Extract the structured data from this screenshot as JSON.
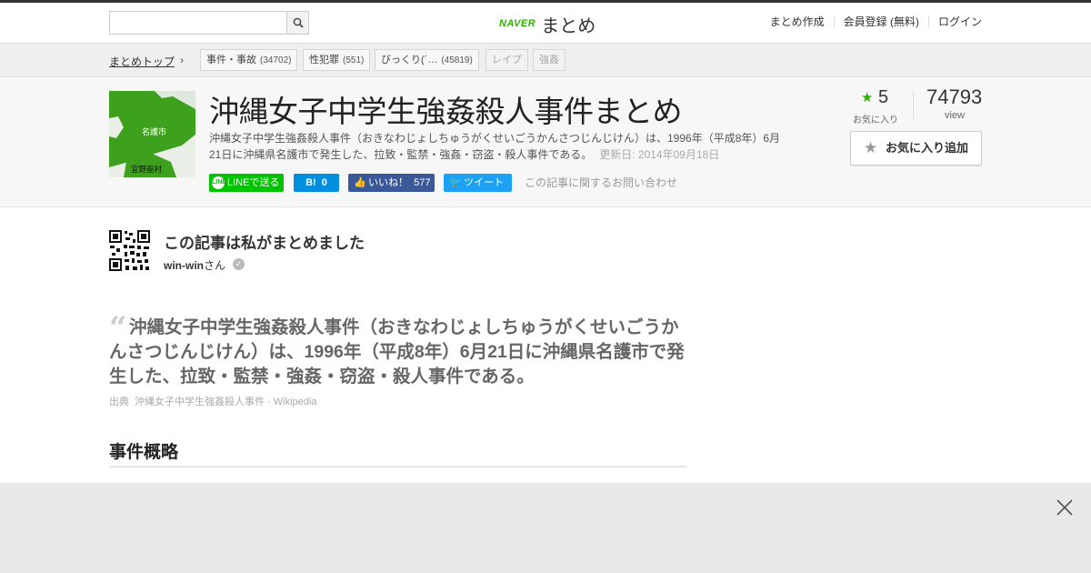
{
  "header": {
    "search": {
      "value": "",
      "placeholder": ""
    },
    "logo": {
      "brand": "NAVER",
      "name": "まとめ"
    },
    "nav": [
      "まとめ作成",
      "会員登録 (無料)",
      "ログイン"
    ]
  },
  "breadcrumb": {
    "top": "まとめトップ",
    "tags": [
      {
        "label": "事件・事故",
        "count": "(34702)"
      },
      {
        "label": "性犯罪",
        "count": "(551)"
      },
      {
        "label": "びっくり(´…",
        "count": "(45819)"
      },
      {
        "label": "レイプ",
        "count": ""
      },
      {
        "label": "強姦",
        "count": ""
      }
    ]
  },
  "article": {
    "thumbnail_labels": [
      "名護市",
      "宜野座村"
    ],
    "title": "沖縄女子中学生強姦殺人事件まとめ",
    "description": "沖縄女子中学生強姦殺人事件（おきなわじょしちゅうがくせいごうかんさつじんじけん）は、1996年（平成8年）6月21日に沖縄県名護市で発生した、拉致・監禁・強姦・窃盗・殺人事件である。",
    "updated": "更新日: 2014年09月18日",
    "share": {
      "line": "LINEで送る",
      "hatena_icon": "B!",
      "hatena_count": "0",
      "facebook": "いいね！",
      "facebook_count": "577",
      "twitter": "ツイート"
    },
    "contact": "この記事に関するお問い合わせ",
    "favorites_count": "5",
    "favorites_label": "お気に入り",
    "views": "74793",
    "views_label": "view",
    "fav_button": "お気に入り追加"
  },
  "author": {
    "heading": "この記事は私がまとめました",
    "name": "win-win",
    "suffix": "さん"
  },
  "content": {
    "quote": "沖縄女子中学生強姦殺人事件（おきなわじょしちゅうがくせいごうかんさつじんじけん）は、1996年（平成8年）6月21日に沖縄県名護市で発生した、拉致・監禁・強姦・窃盗・殺人事件である。",
    "source_label": "出典",
    "source_link": "沖縄女子中学生強姦殺人事件 - Wikipedia",
    "section_title": "事件概略"
  },
  "colors": {
    "brand_green": "#2db400",
    "line": "#00c300",
    "hatena": "#008fde",
    "facebook": "#3b5998",
    "twitter": "#1da1f2"
  },
  "icons": [
    "search-icon",
    "chevron-right-icon",
    "star-icon",
    "line-icon",
    "facebook-icon",
    "twitter-icon",
    "quote-icon",
    "verified-icon",
    "close-icon",
    "qr-code-icon"
  ]
}
